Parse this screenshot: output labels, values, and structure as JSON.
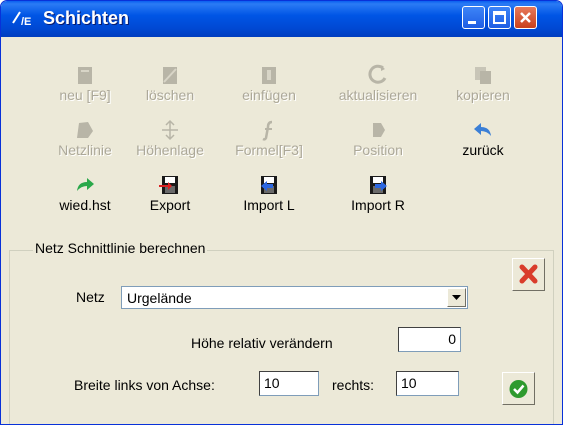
{
  "window": {
    "title": "Schichten"
  },
  "toolbar": {
    "row1": [
      {
        "label": "neu [F9]",
        "icon": "new-icon",
        "enabled": false
      },
      {
        "label": "löschen",
        "icon": "delete-icon",
        "enabled": false
      },
      {
        "label": "einfügen",
        "icon": "insert-icon",
        "enabled": false
      },
      {
        "label": "aktualisieren",
        "icon": "refresh-icon",
        "enabled": false
      },
      {
        "label": "kopieren",
        "icon": "copy-icon",
        "enabled": false
      }
    ],
    "row2": [
      {
        "label": "Netzlinie",
        "icon": "mesh-line-icon",
        "enabled": false
      },
      {
        "label": "Höhenlage",
        "icon": "height-position-icon",
        "enabled": false
      },
      {
        "label": "Formel[F3]",
        "icon": "formula-icon",
        "enabled": false
      },
      {
        "label": "Position",
        "icon": "position-icon",
        "enabled": false
      },
      {
        "label": "zurück",
        "icon": "undo-icon",
        "enabled": true
      }
    ],
    "row3": [
      {
        "label": "wied.hst",
        "icon": "redo-icon",
        "enabled": true
      },
      {
        "label": "Export",
        "icon": "export-disk-icon",
        "enabled": true
      },
      {
        "label": "Import L",
        "icon": "import-left-icon",
        "enabled": true
      },
      {
        "label": "Import R",
        "icon": "import-right-icon",
        "enabled": true
      }
    ]
  },
  "group": {
    "legend": "Netz Schnittlinie berechnen",
    "netz_label": "Netz",
    "netz_value": "Urgelände",
    "height_label": "Höhe relativ verändern",
    "height_value": "0",
    "width_left_label": "Breite links von Achse:",
    "width_left_value": "10",
    "right_label": "rechts:",
    "right_value": "10"
  },
  "colors": {
    "titlebar": "#0055e5",
    "face": "#ece9d8",
    "disabled_text": "#aca899",
    "close_red": "#d93c2b",
    "ok_green": "#2e9a2e"
  }
}
